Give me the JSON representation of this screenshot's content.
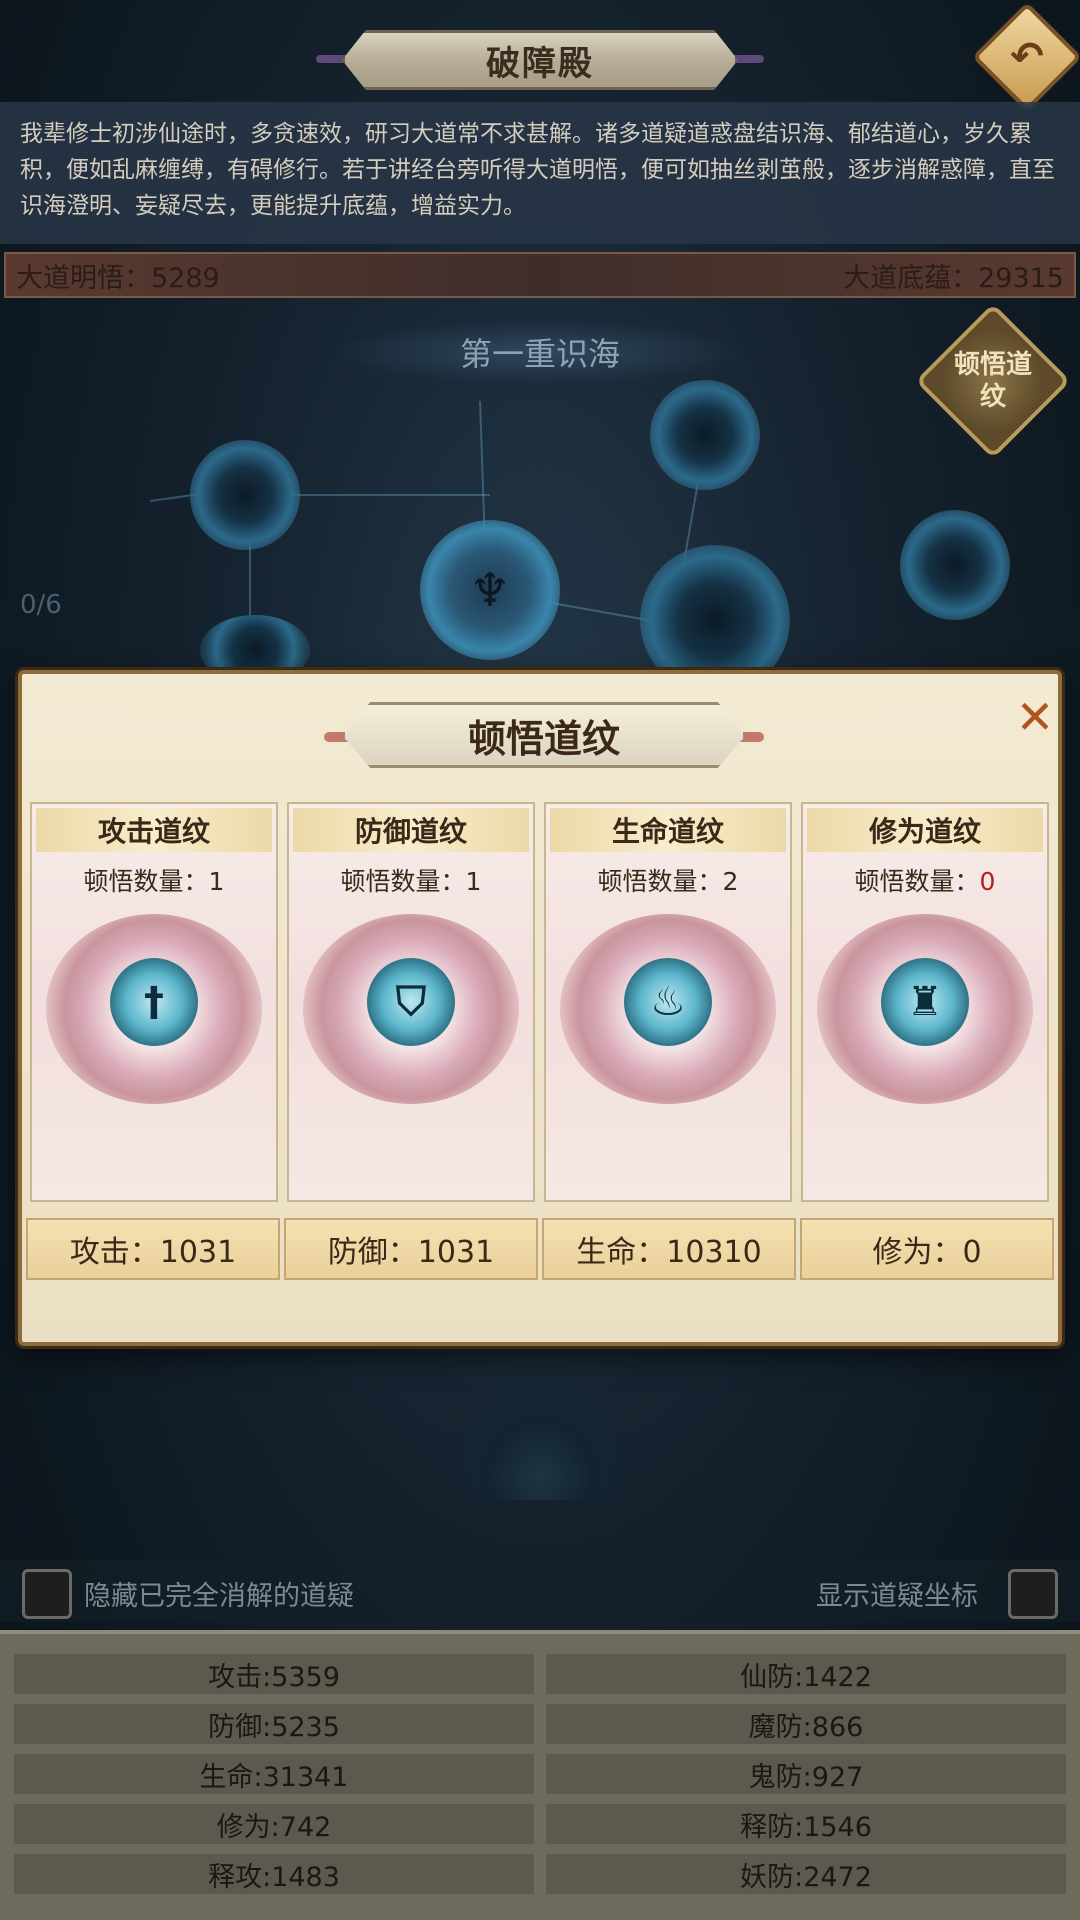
{
  "header": {
    "title": "破障殿",
    "back_icon": "back-arrow-icon",
    "intro": "我辈修士初涉仙途时，多贪速效，研习大道常不求甚解。诸多道疑道惑盘结识海、郁结道心，岁久累积，便如乱麻缠缚，有碍修行。若于讲经台旁听得大道明悟，便可如抽丝剥茧般，逐步消解惑障，直至识海澄明、妄疑尽去，更能提升底蕴，增益实力。"
  },
  "resources": {
    "left_label": "大道明悟：",
    "left_value": "5289",
    "right_label": "大道底蕴：",
    "right_value": "29315"
  },
  "map": {
    "layer_label": "第一重识海",
    "progress": "0/6",
    "insight_button": "顿悟道纹"
  },
  "modal": {
    "title": "顿悟道纹",
    "close_icon": "close-icon",
    "cards": [
      {
        "title": "攻击道纹",
        "count_label": "顿悟数量：",
        "count": "1",
        "icon": "sword-rune-icon"
      },
      {
        "title": "防御道纹",
        "count_label": "顿悟数量：",
        "count": "1",
        "icon": "shield-rune-icon"
      },
      {
        "title": "生命道纹",
        "count_label": "顿悟数量：",
        "count": "2",
        "icon": "flame-rune-icon"
      },
      {
        "title": "修为道纹",
        "count_label": "顿悟数量：",
        "count": "0",
        "icon": "pagoda-rune-icon"
      }
    ],
    "values": [
      "攻击：1031",
      "防御：1031",
      "生命：10310",
      "修为：0"
    ]
  },
  "toggles": {
    "hide_resolved": "隐藏已完全消解的道疑",
    "show_coords": "显示道疑坐标"
  },
  "stats": {
    "left": [
      "攻击:5359",
      "防御:5235",
      "生命:31341",
      "修为:742",
      "释攻:1483"
    ],
    "right": [
      "仙防:1422",
      "魔防:866",
      "鬼防:927",
      "释防:1546",
      "妖防:2472"
    ]
  },
  "colors": {
    "accent_red": "#b0201a",
    "modal_bg": "#f3ead3",
    "gold": "#c99a52"
  }
}
